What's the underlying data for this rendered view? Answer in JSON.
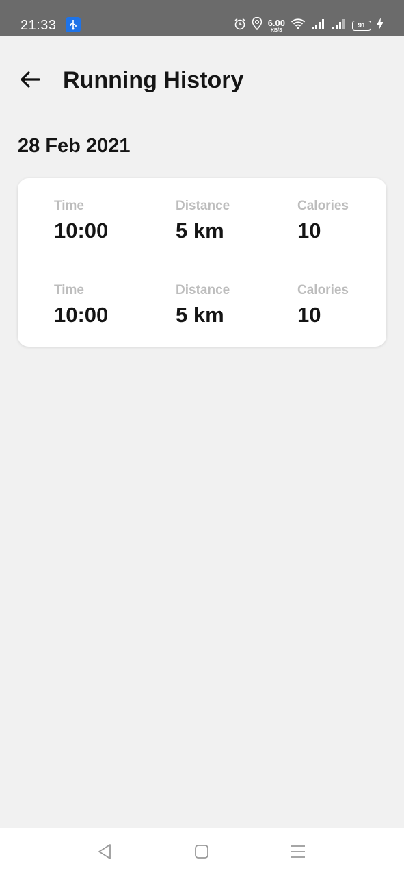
{
  "status_bar": {
    "time": "21:33",
    "network_speed_value": "6.00",
    "network_speed_unit": "KB/S",
    "battery": "91",
    "icons": [
      "usb-icon",
      "alarm-icon",
      "location-icon",
      "wifi-icon",
      "signal-icon",
      "signal-icon",
      "battery-icon",
      "charging-icon"
    ]
  },
  "header": {
    "title": "Running History",
    "back_icon": "arrow-left-icon"
  },
  "history": {
    "date": "28 Feb 2021",
    "runs": [
      {
        "time_label": "Time",
        "time": "10:00",
        "distance_label": "Distance",
        "distance": "5 km",
        "calories_label": "Calories",
        "calories": "10"
      },
      {
        "time_label": "Time",
        "time": "10:00",
        "distance_label": "Distance",
        "distance": "5 km",
        "calories_label": "Calories",
        "calories": "10"
      }
    ]
  },
  "nav_bar": {
    "icons": [
      "back-triangle-icon",
      "home-square-icon",
      "menu-lines-icon"
    ]
  },
  "colors": {
    "background": "#f1f1f1",
    "status_bar": "#6b6b6b",
    "label_gray": "#bdbdbd",
    "text_dark": "#151515",
    "usb_blue": "#1e73e8"
  }
}
